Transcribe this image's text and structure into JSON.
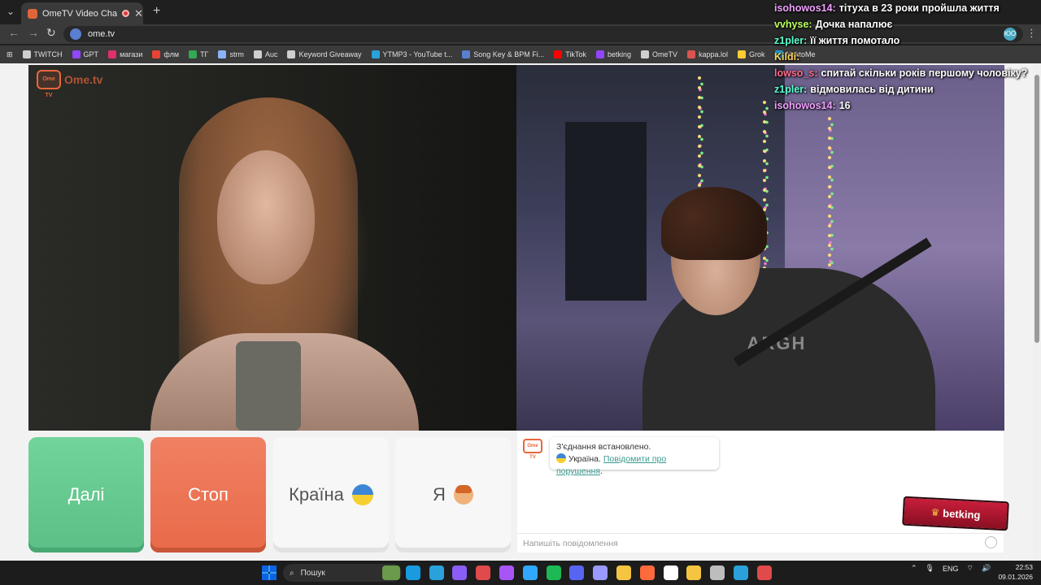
{
  "browser": {
    "tab_title": "OmeTV Video Chat — Ome",
    "url": "ome.tv",
    "new_tab": "+",
    "tab_close": "✕",
    "profile_initial": "ЮО",
    "bookmarks": [
      "TWITCH",
      "GPT",
      "магази",
      "флм",
      "TГ",
      "strm",
      "Auc",
      "Keyword Giveaway",
      "YTMP3 - YouTube t...",
      "Song Key & BPM Fi...",
      "TikTok",
      "betking",
      "OmeTV",
      "kappa.lol",
      "Grok",
      "NektoMe"
    ],
    "bookmark_colors": [
      "#cfcfcf",
      "#9146ff",
      "#e1306c",
      "#ea4335",
      "#34a853",
      "#8ab4f8",
      "#cfcfcf",
      "#cfcfcf",
      "#2aa1da",
      "#5a7fd0",
      "#ff0000",
      "#9146ff",
      "#cfcfcf",
      "#d9534f",
      "#ffcc33",
      "#1fa1d9",
      "#3c6be0",
      "#ffffff",
      "#e0283a",
      "#e8673c",
      "#6ab04c",
      "#d0d0d0",
      "#3a9ad9"
    ]
  },
  "overlay_chat": [
    {
      "user": "isohowos14:",
      "color": "#f0a0ff",
      "text": "тітуха в 23 роки пройшла життя"
    },
    {
      "user": "vvhyse:",
      "color": "#b8ff5c",
      "text": "Дочка напалює"
    },
    {
      "user": "z1pler:",
      "color": "#5cffd0",
      "text": "її життя помотало"
    },
    {
      "user": "Kildi:",
      "color": "#ffd35c",
      "text": ""
    },
    {
      "user": "lowso_s:",
      "color": "#ff6b8a",
      "text": "спитай скільки років першому чоловіку?"
    },
    {
      "user": "z1pler:",
      "color": "#5cffd0",
      "text": "відмовилась від дитини"
    },
    {
      "user": "isohowos14:",
      "color": "#f0a0ff",
      "text": "16"
    }
  ],
  "video_left": {
    "brand": "Ome.tv",
    "logo_badge": "Ome TV"
  },
  "video_right": {
    "shirt_text": "ARGH"
  },
  "controls": {
    "next_label": "Далі",
    "stop_label": "Стоп",
    "country_label": "Країна",
    "me_label": "Я"
  },
  "chat": {
    "logo_badge": "Ome TV",
    "connected_message": "З'єднання встановлено.",
    "country_name": "Україна.",
    "report_link": "Повідомити про порушення",
    "report_suffix": ".",
    "input_placeholder": "Напишіть повідомлення",
    "badge_text": "betking"
  },
  "taskbar": {
    "search_placeholder": "Пошук",
    "language": "ENG",
    "time": "22:53",
    "date": "09.01.2026",
    "icon_colors": [
      "#6a9a4a",
      "#1a9adf",
      "#2aa1da",
      "#8b5cf6",
      "#e04a4a",
      "#a855f7",
      "#31a8ff",
      "#1db954",
      "#5865f2",
      "#9999ff",
      "#f5c542",
      "#ff6a3d",
      "#ffffff",
      "#f5c542",
      "#bdbdbd",
      "#2aa1da",
      "#e04a4a"
    ]
  }
}
